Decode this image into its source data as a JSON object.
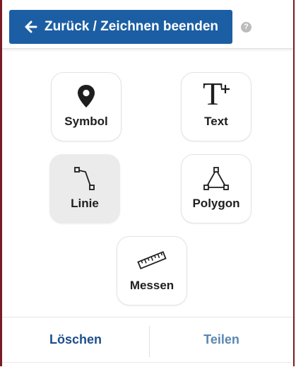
{
  "header": {
    "back_label": "Zurück / Zeichnen beenden",
    "help_glyph": "?"
  },
  "tools": {
    "symbol": {
      "label": "Symbol",
      "icon": "map-pin-icon"
    },
    "text": {
      "label": "Text",
      "icon": "text-add-icon",
      "glyph": "T"
    },
    "line": {
      "label": "Linie",
      "icon": "line-icon",
      "active": true
    },
    "polygon": {
      "label": "Polygon",
      "icon": "polygon-icon"
    },
    "measure": {
      "label": "Messen",
      "icon": "ruler-icon"
    }
  },
  "actions": {
    "delete_label": "Löschen",
    "share_label": "Teilen"
  },
  "colors": {
    "primary": "#1b5ea3",
    "frame": "#7a1c24",
    "active_tool_bg": "#ebebeb",
    "share_text": "#5b86b3"
  }
}
